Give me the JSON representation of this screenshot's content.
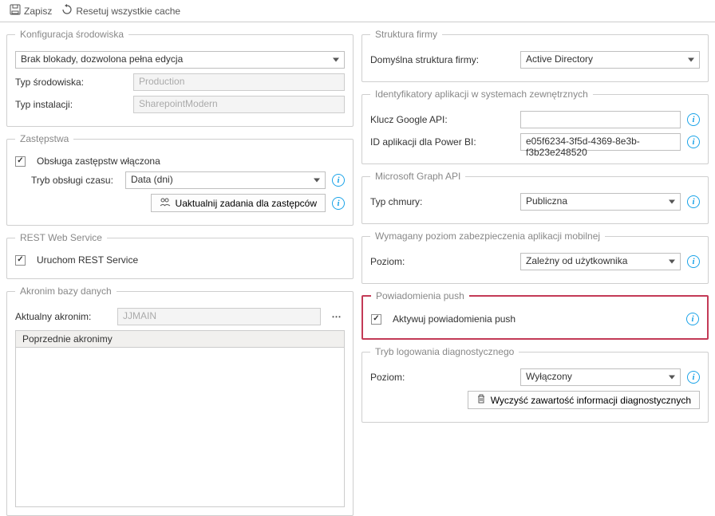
{
  "toolbar": {
    "save": "Zapisz",
    "reset": "Resetuj wszystkie cache"
  },
  "left": {
    "envConfig": {
      "legend": "Konfiguracja środowiska",
      "lockMode": "Brak blokady, dozwolona pełna edycja",
      "envTypeLabel": "Typ środowiska:",
      "envTypeValue": "Production",
      "installTypeLabel": "Typ instalacji:",
      "installTypeValue": "SharepointModern"
    },
    "substitutions": {
      "legend": "Zastępstwa",
      "enabled": "Obsługa zastępstw włączona",
      "timeModeLabel": "Tryb obsługi czasu:",
      "timeModeValue": "Data (dni)",
      "updateBtn": "Uaktualnij zadania dla zastępców"
    },
    "rest": {
      "legend": "REST Web Service",
      "run": "Uruchom REST Service"
    },
    "acronym": {
      "legend": "Akronim bazy danych",
      "currentLabel": "Aktualny akronim:",
      "currentValue": "JJMAIN",
      "prevHeader": "Poprzednie akronimy"
    }
  },
  "right": {
    "structure": {
      "legend": "Struktura firmy",
      "label": "Domyślna struktura firmy:",
      "value": "Active Directory"
    },
    "externalIds": {
      "legend": "Identyfikatory aplikacji w systemach zewnętrznych",
      "googleKeyLabel": "Klucz Google API:",
      "googleKeyValue": "",
      "powerBiLabel": "ID aplikacji dla Power BI:",
      "powerBiValue": "e05f6234-3f5d-4369-8e3b-f3b23e248520"
    },
    "graph": {
      "legend": "Microsoft Graph API",
      "cloudLabel": "Typ chmury:",
      "cloudValue": "Publiczna"
    },
    "mobileSecurity": {
      "legend": "Wymagany poziom zabezpieczenia aplikacji mobilnej",
      "levelLabel": "Poziom:",
      "levelValue": "Zależny od użytkownika"
    },
    "push": {
      "legend": "Powiadomienia push",
      "enable": "Aktywuj powiadomienia push"
    },
    "diag": {
      "legend": "Tryb logowania diagnostycznego",
      "levelLabel": "Poziom:",
      "levelValue": "Wyłączony",
      "clearBtn": "Wyczyść zawartość informacji diagnostycznych"
    }
  }
}
